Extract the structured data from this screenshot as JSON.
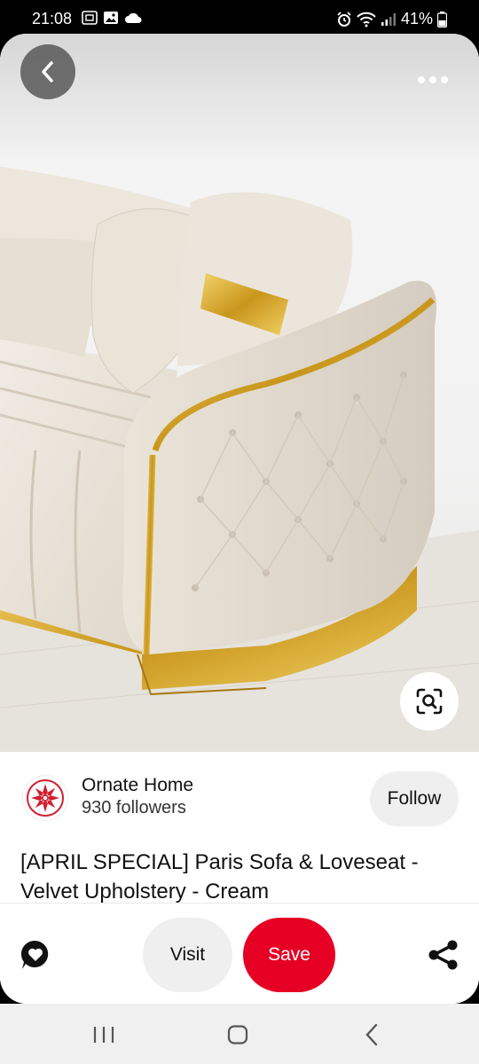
{
  "status_bar": {
    "time": "21:08",
    "battery": "41%",
    "icons": [
      "screenshot-icon",
      "gallery-icon",
      "cloud-icon",
      "alarm-icon",
      "wifi-icon",
      "signal-icon",
      "battery-icon"
    ]
  },
  "pin": {
    "image_subject": "cream tufted velvet sofa with gold trim",
    "creator": {
      "name": "Ornate Home",
      "followers": "930 followers",
      "avatar_color": "#d1202f"
    },
    "follow_label": "Follow",
    "title": "[APRIL SPECIAL] Paris Sofa & Loveseat - Velvet Upholstery - Cream"
  },
  "actions": {
    "visit_label": "Visit",
    "save_label": "Save",
    "save_color": "#e60023"
  },
  "nav_bar": {
    "items": [
      "recents-icon",
      "home-icon",
      "back-icon"
    ]
  }
}
